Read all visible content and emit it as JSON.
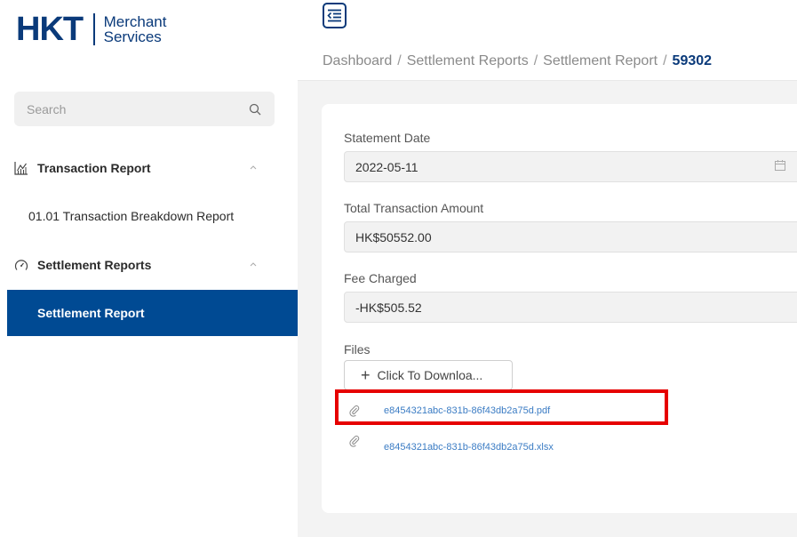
{
  "brand": {
    "logo_main": "HKT",
    "logo_line1": "Merchant",
    "logo_line2": "Services"
  },
  "search": {
    "placeholder": "Search"
  },
  "sidebar": {
    "groups": [
      {
        "label": "Transaction Report",
        "items": [
          {
            "label": "01.01 Transaction Breakdown Report"
          }
        ]
      },
      {
        "label": "Settlement Reports",
        "items": [
          {
            "label": "Settlement Report"
          }
        ]
      }
    ]
  },
  "breadcrumb": {
    "items": [
      "Dashboard",
      "Settlement Reports",
      "Settlement Report"
    ],
    "current": "59302"
  },
  "form": {
    "statement_date": {
      "label": "Statement Date",
      "value": "2022-05-11"
    },
    "total_amount": {
      "label": "Total Transaction Amount",
      "value": "HK$50552.00"
    },
    "fee_charged": {
      "label": "Fee Charged",
      "value": "-HK$505.52"
    },
    "files": {
      "label": "Files",
      "download_label": "Click To Downloa...",
      "items": [
        {
          "name": "e8454321abc-831b-86f43db2a75d.pdf"
        },
        {
          "name": "e8454321abc-831b-86f43db2a75d.xlsx"
        }
      ]
    }
  },
  "colors": {
    "primary": "#004a93",
    "brand": "#0a3a7a",
    "link": "#3b7cc4",
    "highlight": "#e60000"
  }
}
